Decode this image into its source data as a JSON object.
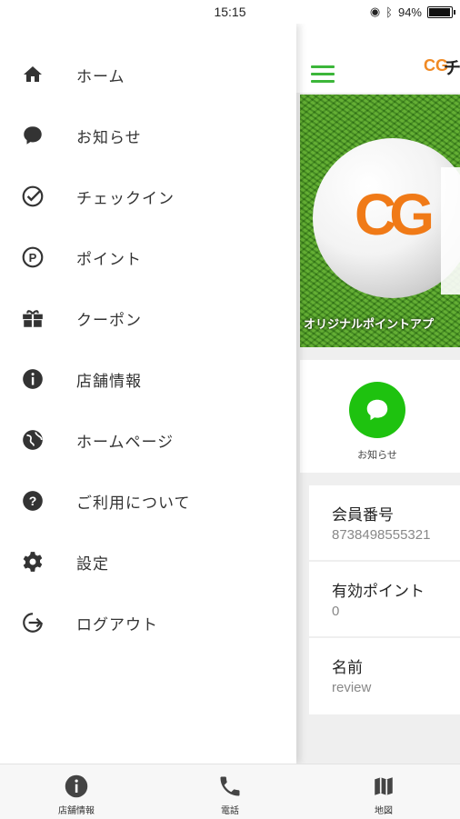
{
  "status_bar": {
    "time": "15:15",
    "battery": "94%"
  },
  "drawer": {
    "items": [
      {
        "label": "ホーム",
        "icon": "home-icon"
      },
      {
        "label": "お知らせ",
        "icon": "chat-bubble-icon"
      },
      {
        "label": "チェックイン",
        "icon": "checkin-icon"
      },
      {
        "label": "ポイント",
        "icon": "point-icon"
      },
      {
        "label": "クーポン",
        "icon": "coupon-icon"
      },
      {
        "label": "店舗情報",
        "icon": "info-icon"
      },
      {
        "label": "ホームページ",
        "icon": "globe-icon"
      },
      {
        "label": "ご利用について",
        "icon": "help-icon"
      },
      {
        "label": "設定",
        "icon": "gear-icon"
      },
      {
        "label": "ログアウト",
        "icon": "logout-icon"
      }
    ]
  },
  "main": {
    "header": {
      "title_partial": "チ"
    },
    "banner": {
      "caption": "オリジナルポイントアプ"
    },
    "notice": {
      "label": "お知らせ"
    },
    "member_number": {
      "title": "会員番号",
      "value": "8738498555321"
    },
    "points": {
      "title": "有効ポイント",
      "value": "0"
    },
    "name": {
      "title": "名前",
      "value": "review"
    }
  },
  "bottom_bar": {
    "items": [
      {
        "label": "店舗情報",
        "icon": "info-icon"
      },
      {
        "label": "電話",
        "icon": "phone-icon"
      },
      {
        "label": "地図",
        "icon": "map-icon"
      }
    ]
  },
  "colors": {
    "accent_green": "#1ec20f",
    "menu_green": "#3cb63a",
    "brand_orange": "#f07a17"
  }
}
